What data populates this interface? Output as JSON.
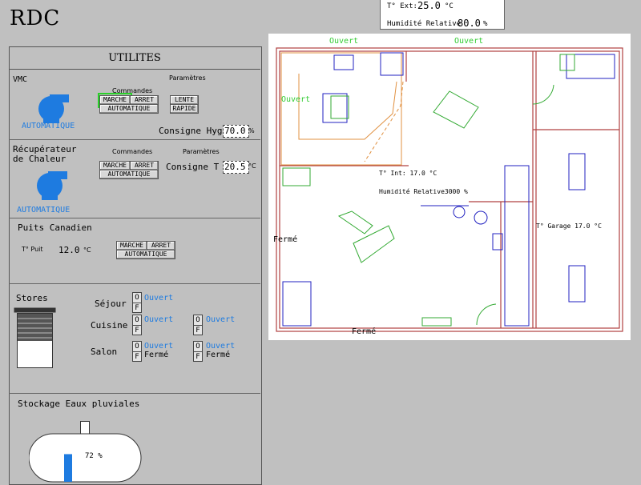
{
  "page": {
    "title": "RDC"
  },
  "exterior": {
    "temp_label": "T° Ext:",
    "temp_value": "25.0",
    "temp_unit": "°C",
    "humidity_label": "Humidité Relative",
    "humidity_value": "80.0",
    "humidity_unit": "%"
  },
  "utilites": {
    "title": "UTILITES",
    "vmc": {
      "title": "VMC",
      "commandes_label": "Commandes",
      "parametres_label": "Paramètres",
      "marche": "MARCHE",
      "arret": "ARRET",
      "automatique_btn": "AUTOMATIQUE",
      "lente": "LENTE",
      "rapide": "RAPIDE",
      "status": "AUTOMATIQUE",
      "consigne_label": "Consigne Hyg",
      "consigne_value": "70.0",
      "consigne_unit": "%"
    },
    "recuperateur": {
      "title_line1": "Récupérateur",
      "title_line2": "de Chaleur",
      "commandes_label": "Commandes",
      "parametres_label": "Paramètres",
      "marche": "MARCHE",
      "arret": "ARRET",
      "automatique_btn": "AUTOMATIQUE",
      "status": "AUTOMATIQUE",
      "consigne_label": "Consigne T",
      "consigne_value": "20.5",
      "consigne_unit": "°C"
    },
    "puits": {
      "title": "Puits Canadien",
      "temp_label": "T° Puit",
      "temp_value": "12.0",
      "temp_unit": "°C",
      "marche": "MARCHE",
      "arret": "ARRET",
      "automatique_btn": "AUTOMATIQUE"
    },
    "stores": {
      "title": "Stores",
      "of_open": "O",
      "of_close": "F",
      "sejour": {
        "label": "Séjour",
        "state": "Ouvert"
      },
      "cuisine": {
        "label": "Cuisine",
        "state1": "Ouvert",
        "state2": "Ouvert"
      },
      "salon": {
        "label": "Salon",
        "state1a": "Ouvert",
        "state1b": "Fermé",
        "state2a": "Ouvert",
        "state2b": "Fermé"
      }
    },
    "stockage": {
      "title": "Stockage Eaux pluviales",
      "level_pct": 72,
      "level_text": "72 %"
    }
  },
  "plan": {
    "labels": {
      "ouvert_top1": "Ouvert",
      "ouvert_top2": "Ouvert",
      "ouvert_left": "Ouvert",
      "ferme_left": "Fermé",
      "ferme_bottom": "Fermé",
      "t_int_label": "T° Int: 17.0",
      "t_int_unit": "°C",
      "hum_int_label": "Humidité Relative",
      "hum_int_value": "3000",
      "hum_int_unit": "%",
      "t_garage": "T° Garage 17.0",
      "t_garage_unit": "°C"
    },
    "colors": {
      "wall": "#b04040",
      "green": "#33aa33",
      "blue": "#2020c0",
      "orange": "#e09040"
    }
  }
}
